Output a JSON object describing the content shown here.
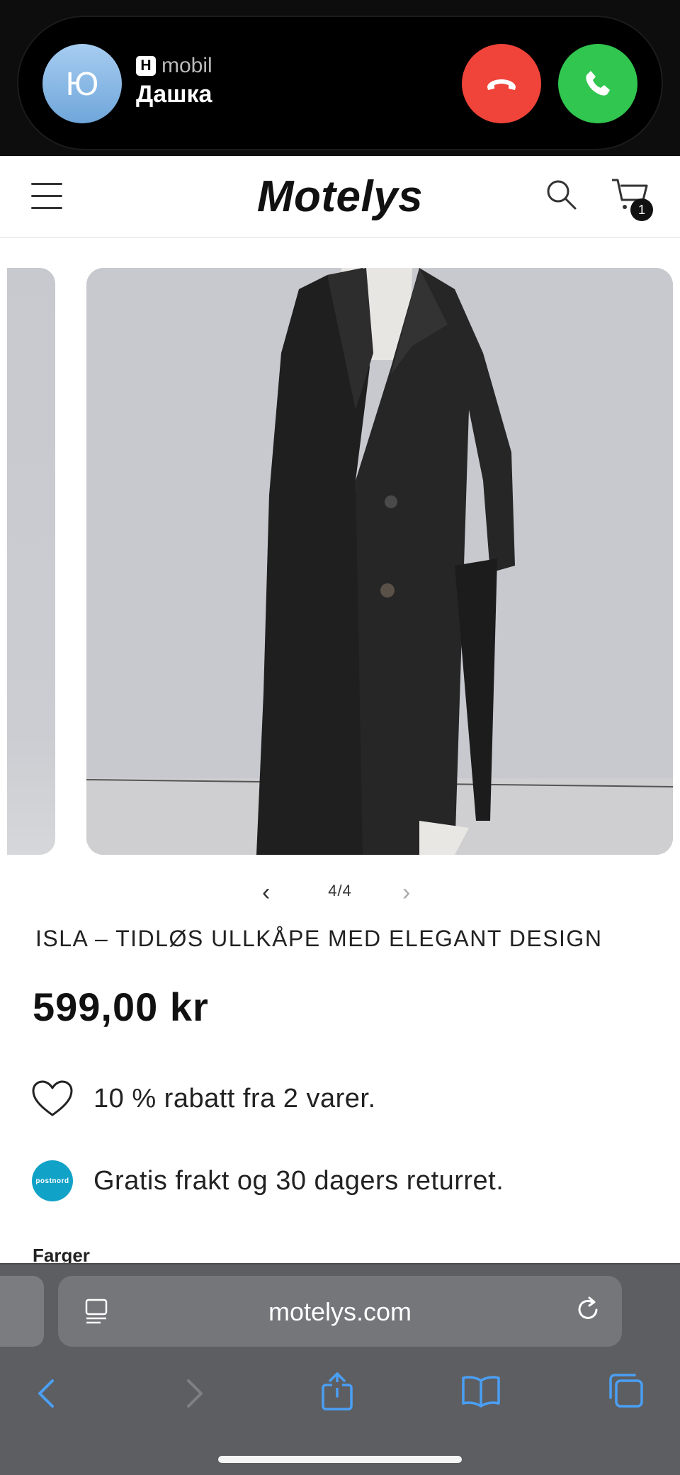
{
  "call": {
    "avatar_initial": "Ю",
    "source_badge": "H",
    "source_label": "mobil",
    "caller_name": "Дашка"
  },
  "header": {
    "logo": "Motelys",
    "cart_count": "1"
  },
  "gallery": {
    "counter": "4/4",
    "prev_glyph": "‹",
    "next_glyph": "›"
  },
  "product": {
    "title": "ISLA – TIDLØS ULLKÅPE MED ELEGANT DESIGN",
    "price": "599,00 kr",
    "perks": [
      {
        "icon": "heart-icon",
        "text": "10 % rabatt fra 2 varer."
      },
      {
        "icon": "postnord-logo",
        "text": "Gratis frakt og 30 dagers returret."
      }
    ],
    "colors_label": "Farger",
    "postnord_logo_text": "postnord"
  },
  "browser": {
    "url": "motelys.com"
  },
  "colors": {
    "decline": "#f0443a",
    "accept": "#30c64f",
    "toolbar_icon": "#4a9ff5",
    "postnord": "#11a2c7"
  }
}
